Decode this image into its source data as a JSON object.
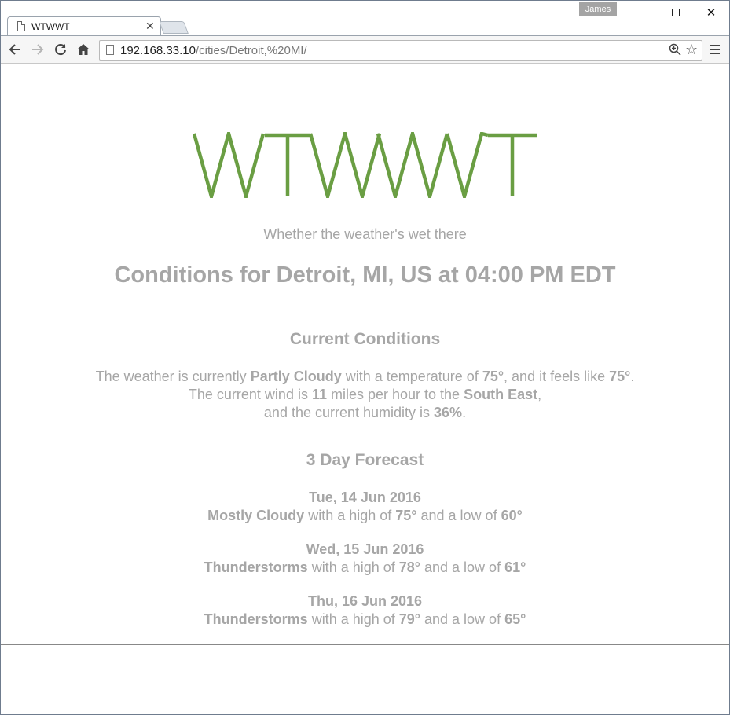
{
  "browser": {
    "tab_title": "WTWWT",
    "user_name": "James",
    "url_host": "192.168.33.10",
    "url_path": "/cities/Detroit,%20MI/",
    "icons": [
      "page-icon",
      "close-icon",
      "back-icon",
      "forward-icon",
      "reload-icon",
      "home-icon",
      "zoom-icon",
      "star-icon",
      "menu-icon",
      "minimize-icon",
      "maximize-icon"
    ]
  },
  "site": {
    "logo": "WTWWT",
    "tagline": "Whether the weather's wet there",
    "logo_color": "#6a9e43",
    "text_color": "#a6a6a6"
  },
  "headline": "Conditions for Detroit, MI, US at 04:00 PM EDT",
  "current": {
    "title": "Current Conditions",
    "line1_prefix": "The weather is currently ",
    "condition": "Partly Cloudy",
    "line1_mid": " with a temperature of ",
    "temperature": "75°",
    "line1_mid2": ", and it feels like ",
    "feels_like": "75°",
    "line1_suffix": ".",
    "line2_prefix": "The current wind is ",
    "wind_speed": "11",
    "line2_mid": " miles per hour to the ",
    "wind_direction": "South East",
    "line2_suffix": ",",
    "line3_prefix": "and the current humidity is ",
    "humidity": "36%",
    "line3_suffix": "."
  },
  "forecast": {
    "title": "3 Day Forecast",
    "high_text": " with a high of ",
    "low_text": " and a low of ",
    "days": [
      {
        "date": "Tue, 14 Jun 2016",
        "condition": "Mostly Cloudy",
        "high": "75°",
        "low": "60°"
      },
      {
        "date": "Wed, 15 Jun 2016",
        "condition": "Thunderstorms",
        "high": "78°",
        "low": "61°"
      },
      {
        "date": "Thu, 16 Jun 2016",
        "condition": "Thunderstorms",
        "high": "79°",
        "low": "65°"
      }
    ]
  }
}
